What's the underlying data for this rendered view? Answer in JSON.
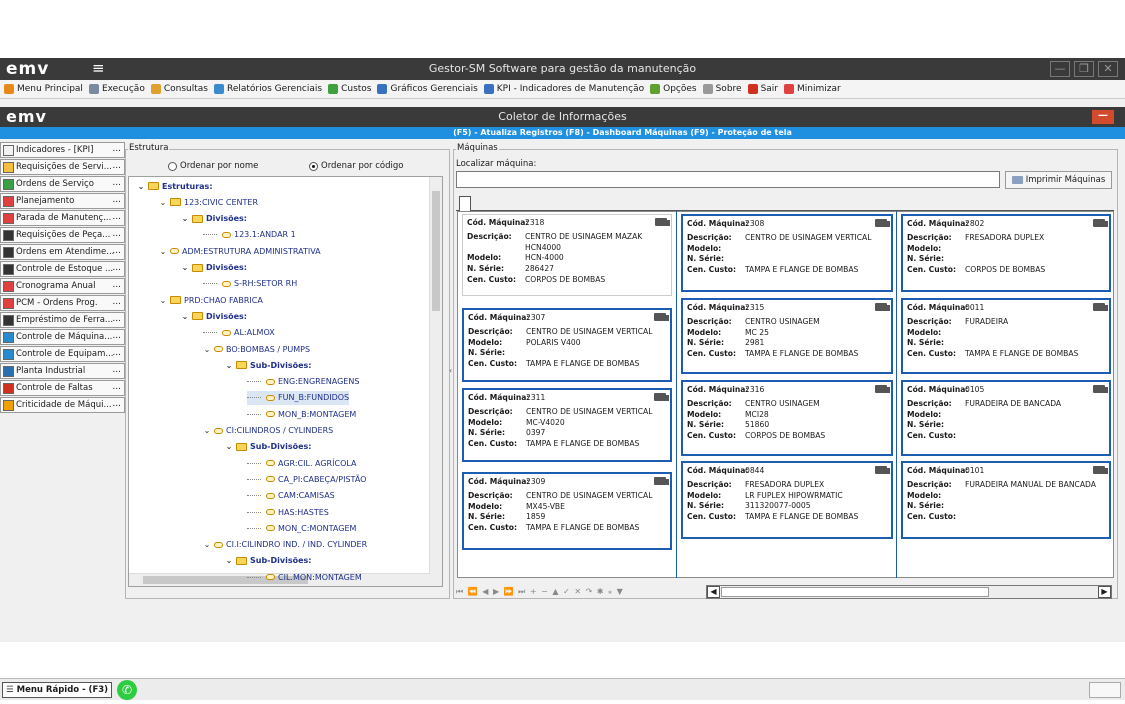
{
  "app": {
    "logo": "emv",
    "title": "Gestor-SM Software para gestão da manutenção",
    "win_min": "—",
    "win_max": "❐",
    "win_close": "✕"
  },
  "menu": [
    {
      "label": "Menu Principal",
      "icon": "home-icon",
      "color": "#e88a1a"
    },
    {
      "label": "Execução",
      "icon": "tools-icon",
      "color": "#7a8aa0"
    },
    {
      "label": "Consultas",
      "icon": "search-icon",
      "color": "#e0a030"
    },
    {
      "label": "Relatórios Gerenciais",
      "icon": "report-icon",
      "color": "#3a8ad0"
    },
    {
      "label": "Custos",
      "icon": "cost-icon",
      "color": "#40a040"
    },
    {
      "label": "Gráficos Gerenciais",
      "icon": "chart-icon",
      "color": "#3a70c0"
    },
    {
      "label": "KPI - Indicadores de Manutenção",
      "icon": "kpi-icon",
      "color": "#3a70c0"
    },
    {
      "label": "Opções",
      "icon": "options-icon",
      "color": "#60a030"
    },
    {
      "label": "Sobre",
      "icon": "about-icon",
      "color": "#999999"
    },
    {
      "label": "Sair",
      "icon": "exit-icon",
      "color": "#d03020"
    },
    {
      "label": "Minimizar",
      "icon": "minimize-icon",
      "color": "#e04040"
    }
  ],
  "coletor": {
    "logo": "emv",
    "title": "Coletor de Informações",
    "close": "—",
    "hotkeys": "(F5) - Atualiza Registros  (F8) - Dashboard Máquinas  (F9) - Proteção de tela",
    "accent": "#1f8fe0"
  },
  "sidebar": [
    {
      "label": "Indicadores - [KPI]",
      "icon": "kpi-icon",
      "color": "#f2f2f2"
    },
    {
      "label": "Requisições de Servi...",
      "icon": "request-icon",
      "color": "#f5c040"
    },
    {
      "label": "Ordens de Serviço",
      "icon": "order-icon",
      "color": "#3aa048"
    },
    {
      "label": "Planejamento",
      "icon": "calendar-icon",
      "color": "#e04040"
    },
    {
      "label": "Parada de Manutenç...",
      "icon": "calendar-icon",
      "color": "#e04040"
    },
    {
      "label": "Requisições de Peça...",
      "icon": "parts-icon",
      "color": "#333333"
    },
    {
      "label": "Ordens em Atendime...",
      "icon": "service-icon",
      "color": "#333333"
    },
    {
      "label": "Controle de Estoque ...",
      "icon": "stock-icon",
      "color": "#333333"
    },
    {
      "label": "Cronograma Anual",
      "icon": "calendar-icon",
      "color": "#e04040"
    },
    {
      "label": "PCM - Ordens Prog.",
      "icon": "pcm-icon",
      "color": "#e04040"
    },
    {
      "label": "Empréstimo de Ferra...",
      "icon": "tool-loan-icon",
      "color": "#333333"
    },
    {
      "label": "Controle de Máquina...",
      "icon": "machine-icon",
      "color": "#2a8ad0"
    },
    {
      "label": "Controle de Equipam...",
      "icon": "equipment-icon",
      "color": "#2a8ad0"
    },
    {
      "label": "Planta Industrial",
      "icon": "plant-icon",
      "color": "#2a70b0"
    },
    {
      "label": "Controle de Faltas",
      "icon": "absence-icon",
      "color": "#d03020"
    },
    {
      "label": "Criticidade de Máqui...",
      "icon": "criticality-icon",
      "color": "#f0a000"
    }
  ],
  "estrutura": {
    "group": "Estrutura",
    "radio_name": "Ordenar por nome",
    "radio_code": "Ordenar por código",
    "tree": [
      {
        "label": "Estruturas:",
        "level": 0,
        "type": "folder",
        "bold": true
      },
      {
        "label": "123:CIVIC CENTER",
        "level": 1,
        "type": "folder"
      },
      {
        "label": "Divisões:",
        "level": 2,
        "type": "folder",
        "bold": true
      },
      {
        "label": "123.1:ANDAR 1",
        "level": 3,
        "type": "leaf"
      },
      {
        "label": "ADM:ESTRUTURA ADMINISTRATIVA",
        "level": 1,
        "type": "leaf-exp"
      },
      {
        "label": "Divisões:",
        "level": 2,
        "type": "folder",
        "bold": true
      },
      {
        "label": "S-RH:SETOR RH",
        "level": 3,
        "type": "leaf"
      },
      {
        "label": "PRD:CHAO FABRICA",
        "level": 1,
        "type": "folder"
      },
      {
        "label": "Divisões:",
        "level": 2,
        "type": "folder",
        "bold": true
      },
      {
        "label": "AL:ALMOX",
        "level": 3,
        "type": "leaf"
      },
      {
        "label": "BO:BOMBAS / PUMPS",
        "level": 3,
        "type": "leaf-exp"
      },
      {
        "label": "Sub-Divisões:",
        "level": 4,
        "type": "folder",
        "bold": true
      },
      {
        "label": "ENG:ENGRENAGENS",
        "level": 5,
        "type": "leaf"
      },
      {
        "label": "FUN_B:FUNDIDOS",
        "level": 5,
        "type": "leaf",
        "selected": true
      },
      {
        "label": "MON_B:MONTAGEM",
        "level": 5,
        "type": "leaf"
      },
      {
        "label": "CI:CILINDROS / CYLINDERS",
        "level": 3,
        "type": "leaf-exp"
      },
      {
        "label": "Sub-Divisões:",
        "level": 4,
        "type": "folder",
        "bold": true
      },
      {
        "label": "AGR:CIL. AGRÍCOLA",
        "level": 5,
        "type": "leaf"
      },
      {
        "label": "CA_PI:CABEÇA/PISTÃO",
        "level": 5,
        "type": "leaf"
      },
      {
        "label": "CAM:CAMISAS",
        "level": 5,
        "type": "leaf"
      },
      {
        "label": "HAS:HASTES",
        "level": 5,
        "type": "leaf"
      },
      {
        "label": "MON_C:MONTAGEM",
        "level": 5,
        "type": "leaf"
      },
      {
        "label": "CI.I:CILINDRO IND. / IND. CYLINDER",
        "level": 3,
        "type": "leaf-exp"
      },
      {
        "label": "Sub-Divisões:",
        "level": 4,
        "type": "folder",
        "bold": true
      },
      {
        "label": "CIL.MON:MONTAGEM",
        "level": 5,
        "type": "leaf"
      }
    ]
  },
  "maquinas": {
    "group": "Máquinas",
    "search_label": "Localizar máquina:",
    "search_value": "",
    "print_button": "Imprimir Máquinas",
    "labels": {
      "cod": "Cód. Máquina:",
      "desc": "Descrição:",
      "model": "Modelo:",
      "serie": "N. Série:",
      "custo": "Cen. Custo:"
    },
    "columns": [
      [
        {
          "cod": "2318",
          "desc": "CENTRO DE USINAGEM MAZAK HCN4000",
          "model": "HCN-4000",
          "serie": "286427",
          "custo": "CORPOS DE BOMBAS",
          "first": true
        },
        {
          "cod": "2307",
          "desc": "CENTRO DE USINAGEM VERTICAL",
          "model": "POLARIS V400",
          "serie": "",
          "custo": "TAMPA E FLANGE DE BOMBAS"
        },
        {
          "cod": "2311",
          "desc": "CENTRO DE USINAGEM VERTICAL",
          "model": "MC-V4020",
          "serie": "0397",
          "custo": "TAMPA E FLANGE DE BOMBAS"
        },
        {
          "cod": "2309",
          "desc": "CENTRO DE USINAGEM VERTICAL",
          "model": "MX45-VBE",
          "serie": "1859",
          "custo": "TAMPA E FLANGE DE BOMBAS"
        }
      ],
      [
        {
          "cod": "2308",
          "desc": "CENTRO DE USINAGEM VERTICAL",
          "model": "",
          "serie": "",
          "custo": "TAMPA E FLANGE DE BOMBAS"
        },
        {
          "cod": "2315",
          "desc": "CENTRO USINAGEM",
          "model": "MC 25",
          "serie": "2981",
          "custo": "TAMPA E FLANGE DE BOMBAS"
        },
        {
          "cod": "2316",
          "desc": "CENTRO USINAGEM",
          "model": "MCI28",
          "serie": "51860",
          "custo": "CORPOS DE BOMBAS"
        },
        {
          "cod": "0844",
          "desc": "FRESADORA DUPLEX",
          "model": "LR FUPLEX HIPOWRMATIC",
          "serie": "311320077-0005",
          "custo": "TAMPA E FLANGE DE BOMBAS"
        }
      ],
      [
        {
          "cod": "2802",
          "desc": "FRESADORA DUPLEX",
          "model": "",
          "serie": "",
          "custo": "CORPOS DE BOMBAS"
        },
        {
          "cod": "0011",
          "desc": "FURADEIRA",
          "model": "",
          "serie": "",
          "custo": "TAMPA E FLANGE DE BOMBAS"
        },
        {
          "cod": "0105",
          "desc": "FURADEIRA DE BANCADA",
          "model": "",
          "serie": "",
          "custo": ""
        },
        {
          "cod": "0101",
          "desc": "FURADEIRA MANUAL DE BANCADA",
          "model": "",
          "serie": "",
          "custo": ""
        }
      ]
    ],
    "nav": "⏮ ⏪ ◀ ▶ ⏩ ⏭ + − ▲ ✓ ✕ ↷ ✱ ⁎ ▼"
  },
  "bottom": {
    "quick_menu": "Menu Rápido - (F3)",
    "whatsapp": "✆"
  }
}
